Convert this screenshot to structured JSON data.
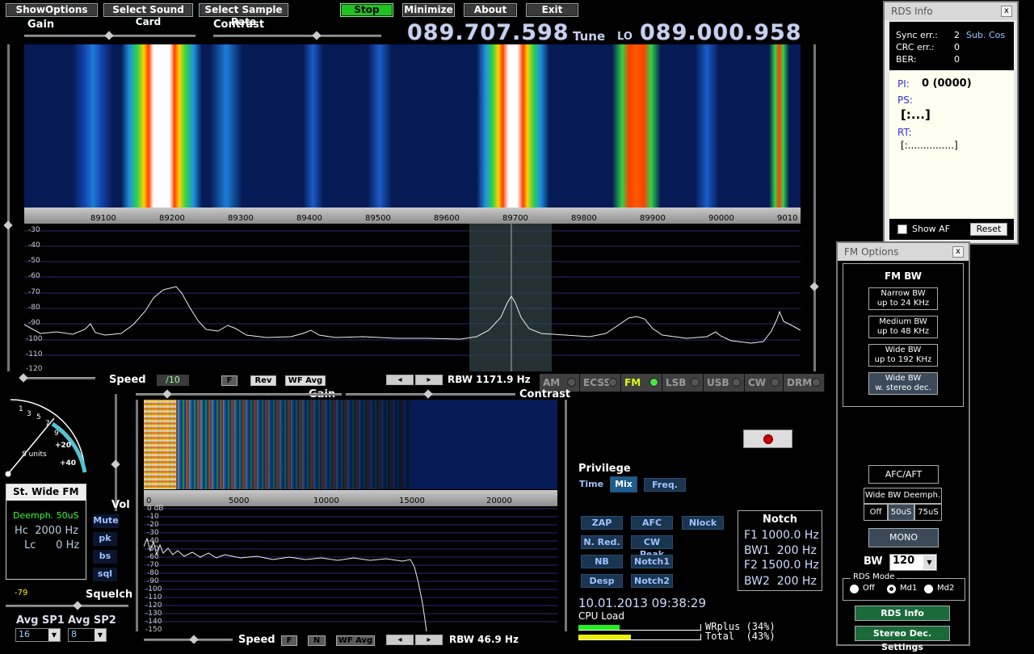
{
  "toolbar": {
    "show_options": "ShowOptions",
    "select_sound_card": "Select Sound Card",
    "select_sample_rate": "Select Sample Rate",
    "stop": "Stop",
    "minimize": "Minimize",
    "about": "About",
    "exit": "Exit"
  },
  "top_labels": {
    "gain": "Gain",
    "contrast": "Contrast"
  },
  "tuning": {
    "tune_freq": "089.707.598",
    "tune_label": "Tune",
    "lo_label": "LO",
    "lo_freq": "089.000.958"
  },
  "main_ruler": [
    "89100",
    "89200",
    "89300",
    "89400",
    "89500",
    "89600",
    "89700",
    "89800",
    "89900",
    "90000",
    "9010"
  ],
  "main_db_scale": [
    "-30",
    "-40",
    "-50",
    "-60",
    "-70",
    "-80",
    "-90",
    "-100",
    "-110",
    "-120"
  ],
  "speed_bar": {
    "speed": "Speed",
    "divider": "/10",
    "f": "F",
    "rev": "Rev",
    "wf_avg": "WF Avg",
    "rbw": "RBW 1171.9 Hz"
  },
  "modes": [
    {
      "label": "AM"
    },
    {
      "label": "ECSS"
    },
    {
      "label": "FM"
    },
    {
      "label": "LSB"
    },
    {
      "label": "USB"
    },
    {
      "label": "CW"
    },
    {
      "label": "DRM"
    }
  ],
  "audio": {
    "gain": "Gain",
    "contrast": "Contrast",
    "ruler": [
      "0",
      "5000",
      "10000",
      "15000",
      "20000"
    ],
    "db_scale": [
      "0 dB",
      "-10",
      "-20",
      "-30",
      "-40",
      "-50",
      "-60",
      "-70",
      "-80",
      "-90",
      "-100",
      "-110",
      "-120",
      "-130",
      "-140",
      "-150"
    ],
    "speed": "Speed",
    "f": "F",
    "n": "N",
    "wf_avg": "WF Avg",
    "rbw": "RBW 46.9 Hz"
  },
  "smeter": {
    "ticks": [
      "1",
      "3",
      "5",
      "7",
      "9",
      "+20",
      "+40"
    ],
    "units": "S units"
  },
  "status_box": {
    "mode": "St. Wide FM",
    "deemph": "Deemph. 50uS",
    "hc": "Hc  2000 Hz",
    "lc": "Lc      0 Hz"
  },
  "side": {
    "vol": "Vol",
    "mute": "Mute",
    "pk": "pk",
    "bs": "bs",
    "sql": "sql",
    "squelch": "Squelch",
    "squelch_value": "-79"
  },
  "avg": {
    "sp1_label": "Avg SP1",
    "sp2_label": "Avg SP2",
    "sp1_value": "16",
    "sp2_value": "8"
  },
  "privilege": {
    "title": "Privilege",
    "time": "Time",
    "mix": "Mix",
    "freq": "Freq."
  },
  "dsp": {
    "zap": "ZAP",
    "afc": "AFC",
    "nlock": "Nlock",
    "nred": "N. Red.",
    "cwpeak": "CW Peak",
    "nb": "NB",
    "notch1": "Notch1",
    "desp": "Desp",
    "notch2": "Notch2"
  },
  "notch": {
    "title": "Notch",
    "f1": "F1 1000.0 Hz",
    "bw1": "BW1  200 Hz",
    "f2": "F2 1500.0 Hz",
    "bw2": "BW2  200 Hz"
  },
  "clock": {
    "datetime": "10.01.2013 09:38:29",
    "cpu": "CPU Load",
    "wrplus": "WRplus (34%)",
    "total": "Total  (43%)",
    "wrplus_pct": 34,
    "total_pct": 43
  },
  "rds": {
    "title": "RDS Info",
    "close": "x",
    "sync_label": "Sync err.:",
    "sync_val": "2",
    "sync_extra": "Sub. Cos",
    "crc_label": "CRC err.:",
    "crc_val": "0",
    "ber_label": "BER:",
    "ber_val": "0",
    "pi_label": "PI:",
    "pi_val": "0 (0000)",
    "ps_label": "PS:",
    "ps_val": "[:...]",
    "rt_label": "RT:",
    "rt_val": "[:...............]",
    "show_af": "Show AF",
    "reset": "Reset"
  },
  "fm": {
    "title": "FM Options",
    "close": "x",
    "bw_title": "FM BW",
    "narrow1": "Narrow BW",
    "narrow2": "up to 24 KHz",
    "medium1": "Medium BW",
    "medium2": "up to 48 KHz",
    "wide1": "Wide BW",
    "wide2": "up to 192 KHz",
    "stereo1": "Wide BW",
    "stereo2": "w. stereo dec.",
    "afc": "AFC/AFT",
    "deemph": "Wide BW Deemph.",
    "off": "Off",
    "us50": "50uS",
    "us75": "75uS",
    "mono": "MONO",
    "bw_label": "BW",
    "bw_value": "120",
    "rds_mode": "RDS Mode",
    "rm_off": "Off",
    "rm_md1": "Md1",
    "rm_md2": "Md2",
    "rds_info": "RDS Info",
    "stereo_settings": "Stereo Dec. Settings"
  }
}
